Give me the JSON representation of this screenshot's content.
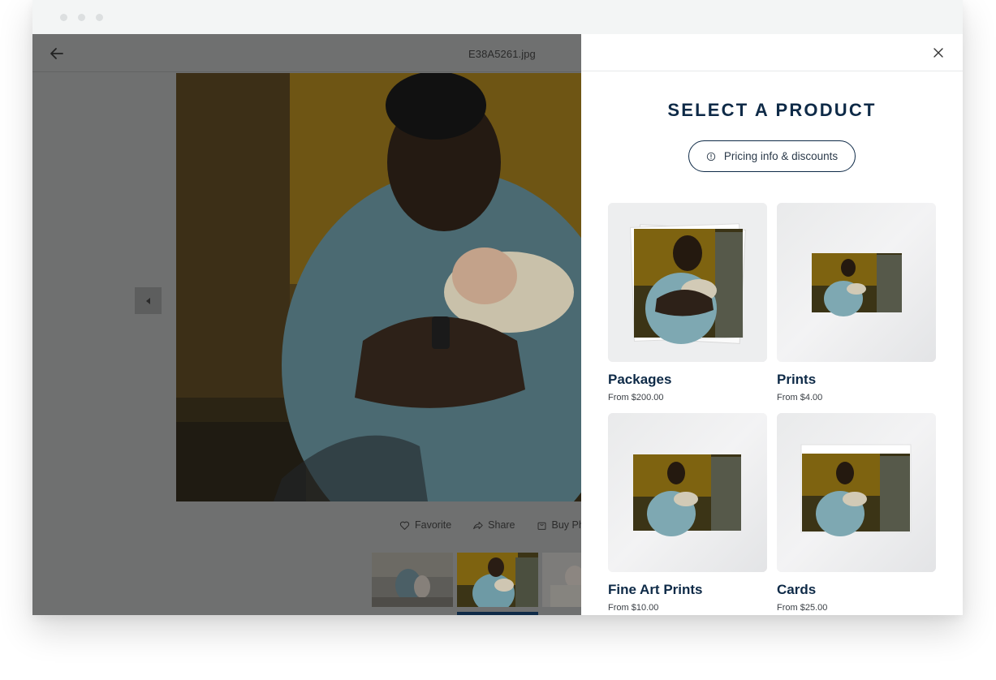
{
  "viewer": {
    "filename": "E38A5261.jpg",
    "actions": {
      "favorite": "Favorite",
      "share": "Share",
      "buy": "Buy Ph"
    }
  },
  "panel": {
    "title": "SELECT A PRODUCT",
    "pricing_button": "Pricing info & discounts",
    "products": [
      {
        "name": "Packages",
        "price": "From $200.00"
      },
      {
        "name": "Prints",
        "price": "From $4.00"
      },
      {
        "name": "Fine Art Prints",
        "price": "From $10.00"
      },
      {
        "name": "Cards",
        "price": "From $25.00"
      }
    ]
  },
  "colors": {
    "navy": "#0e2a47",
    "overlay": "#6f7070",
    "photo_wall": "#c89a1e",
    "shirt": "#8fb6c2"
  }
}
